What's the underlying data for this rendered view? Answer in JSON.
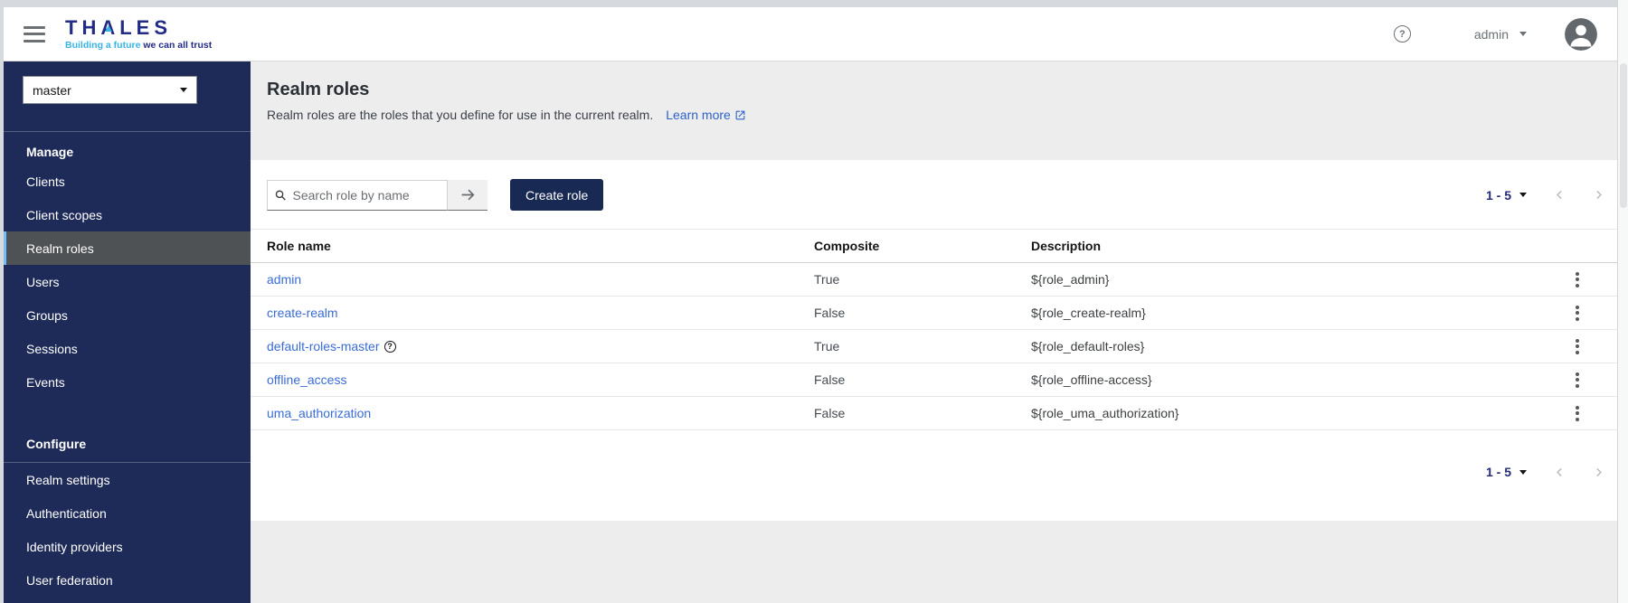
{
  "header": {
    "logo": {
      "brand": "THALES",
      "tagline_accent": "Building a future",
      "tagline_rest": " we can all trust"
    },
    "help_icon": "question-circle-icon",
    "help_glyph": "?",
    "user_label": "admin"
  },
  "sidebar": {
    "realm_selector": {
      "value": "master"
    },
    "sections": [
      {
        "label": "Manage",
        "items": [
          {
            "label": "Clients",
            "selected": false
          },
          {
            "label": "Client scopes",
            "selected": false
          },
          {
            "label": "Realm roles",
            "selected": true
          },
          {
            "label": "Users",
            "selected": false
          },
          {
            "label": "Groups",
            "selected": false
          },
          {
            "label": "Sessions",
            "selected": false
          },
          {
            "label": "Events",
            "selected": false
          }
        ]
      },
      {
        "label": "Configure",
        "items": [
          {
            "label": "Realm settings",
            "selected": false
          },
          {
            "label": "Authentication",
            "selected": false
          },
          {
            "label": "Identity providers",
            "selected": false
          },
          {
            "label": "User federation",
            "selected": false
          }
        ]
      }
    ]
  },
  "page": {
    "title": "Realm roles",
    "subtitle": "Realm roles are the roles that you define for use in the current realm.",
    "learn_more_label": "Learn more"
  },
  "toolbar": {
    "search_placeholder": "Search role by name",
    "create_button_label": "Create role",
    "pagination": {
      "range": "1 - 5"
    }
  },
  "table": {
    "columns": [
      "Role name",
      "Composite",
      "Description"
    ],
    "rows": [
      {
        "name": "admin",
        "composite": "True",
        "description": "${role_admin}"
      },
      {
        "name": "create-realm",
        "composite": "False",
        "description": "${role_create-realm}"
      },
      {
        "name": "default-roles-master",
        "composite": "True",
        "description": "${role_default-roles}",
        "help_glyph": "?"
      },
      {
        "name": "offline_access",
        "composite": "False",
        "description": "${role_offline-access}"
      },
      {
        "name": "uma_authorization",
        "composite": "False",
        "description": "${role_uma_authorization}"
      }
    ]
  },
  "pagination_bottom": {
    "range": "1 - 5"
  },
  "colors": {
    "accent": "#182a54",
    "sidebar-bg": "#1e2b58",
    "selected-bg": "#4f5255",
    "selected-bar": "#73bcf7",
    "link": "#3a6cd6",
    "logo-navy": "#232c85",
    "logo-cyan": "#35b4e5",
    "text": "#151515",
    "muted": "#6a7075",
    "gray-bg": "#ededed",
    "border": "#d2d2d2",
    "row-border": "#e7e7e7"
  }
}
